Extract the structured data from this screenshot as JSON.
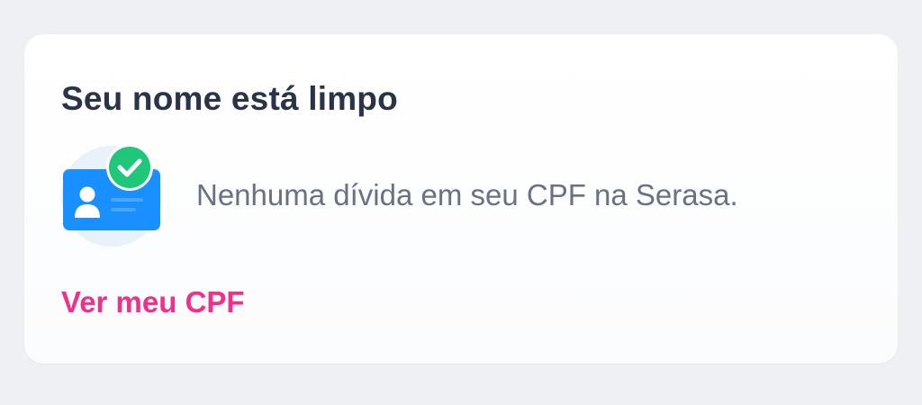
{
  "card": {
    "title": "Seu nome está limpo",
    "status_icon": "id-card-check-icon",
    "status_text": "Nenhuma dívida em seu CPF na Serasa.",
    "link_label": "Ver meu CPF"
  },
  "colors": {
    "title": "#2b3348",
    "body_text": "#6b7084",
    "link": "#f0308a",
    "card_blue": "#1a8fff",
    "check_green": "#1fc77a",
    "background": "#eef0f3"
  }
}
